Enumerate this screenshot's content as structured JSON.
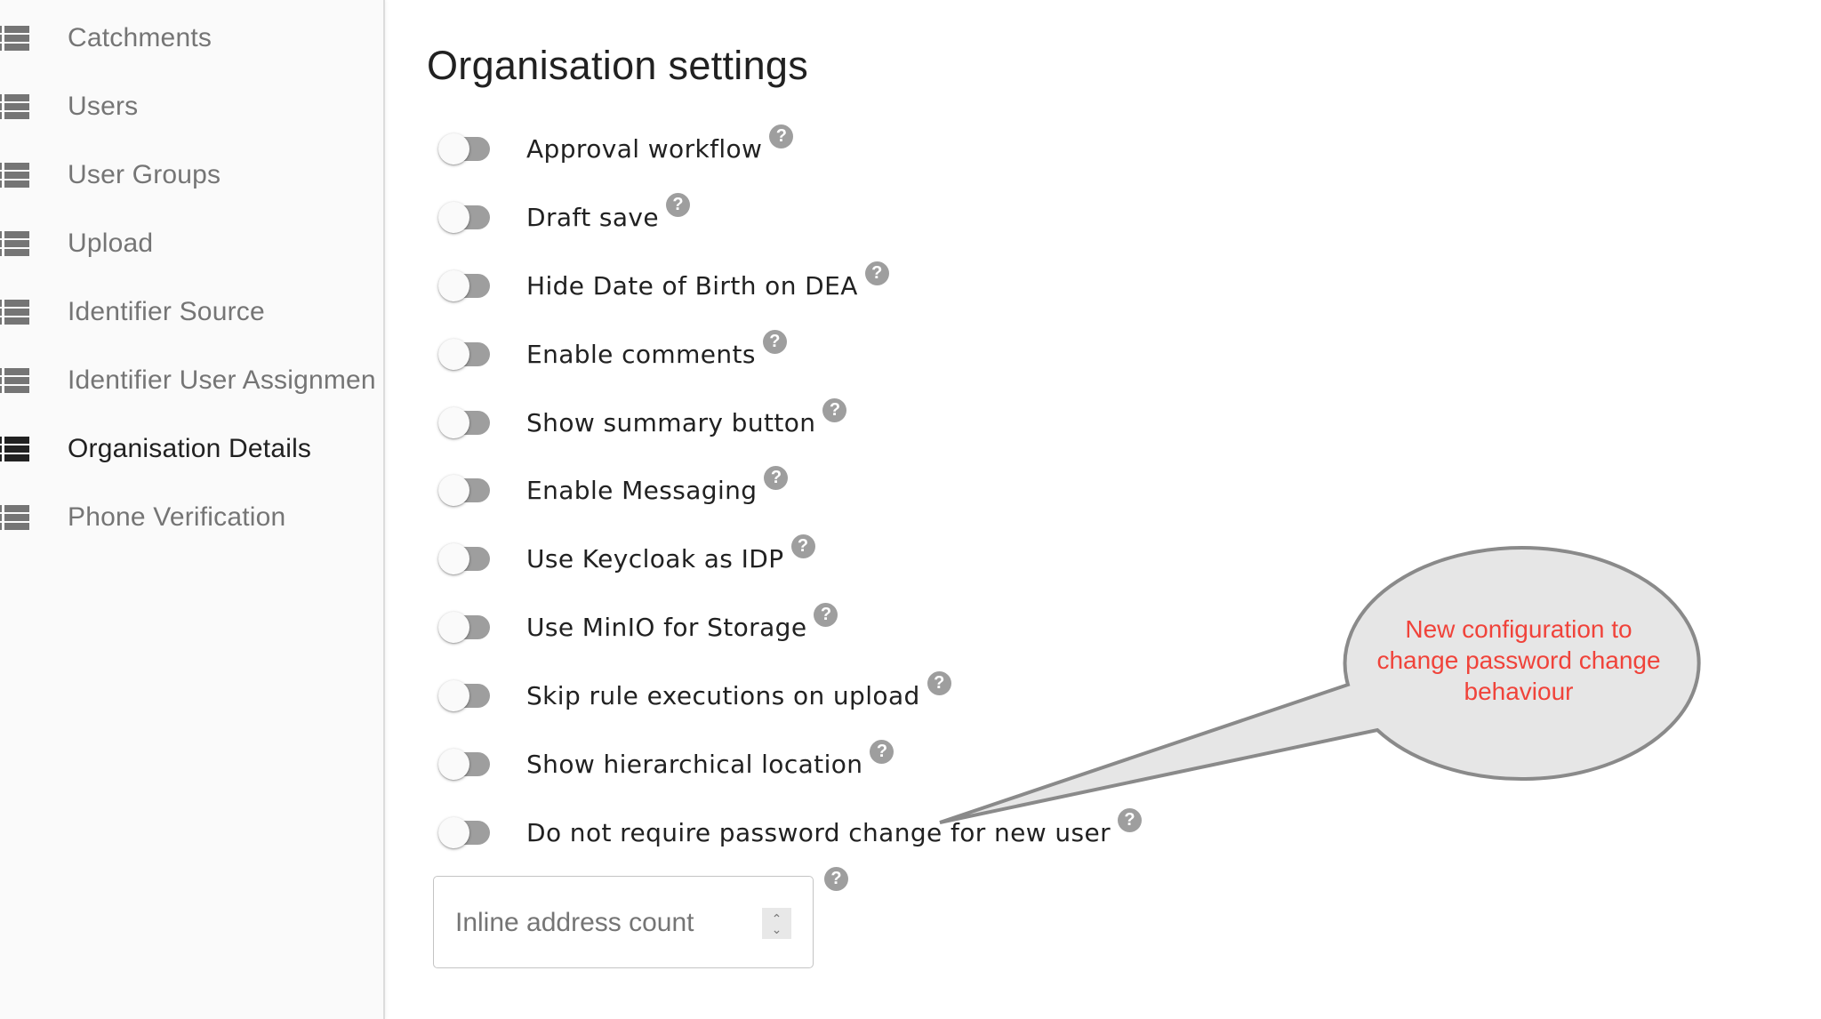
{
  "sidebar": {
    "items": [
      {
        "label": "Catchments",
        "icon": "view-list-icon",
        "active": false
      },
      {
        "label": "Users",
        "icon": "view-list-icon",
        "active": false
      },
      {
        "label": "User Groups",
        "icon": "view-list-icon",
        "active": false
      },
      {
        "label": "Upload",
        "icon": "view-list-icon",
        "active": false
      },
      {
        "label": "Identifier Source",
        "icon": "view-list-icon",
        "active": false
      },
      {
        "label": "Identifier User Assignmen",
        "icon": "view-list-icon",
        "active": false
      },
      {
        "label": "Organisation Details",
        "icon": "view-list-icon",
        "active": true
      },
      {
        "label": "Phone Verification",
        "icon": "view-list-icon",
        "active": false
      }
    ]
  },
  "main": {
    "title": "Organisation settings",
    "settings": [
      {
        "label": "Approval workflow",
        "enabled": false,
        "help": "?"
      },
      {
        "label": "Draft save",
        "enabled": false,
        "help": "?"
      },
      {
        "label": "Hide Date of Birth on DEA",
        "enabled": false,
        "help": "?"
      },
      {
        "label": "Enable comments",
        "enabled": false,
        "help": "?"
      },
      {
        "label": "Show summary button",
        "enabled": false,
        "help": "?"
      },
      {
        "label": "Enable Messaging",
        "enabled": false,
        "help": "?"
      },
      {
        "label": "Use Keycloak as IDP",
        "enabled": false,
        "help": "?"
      },
      {
        "label": "Use MinIO for Storage",
        "enabled": false,
        "help": "?"
      },
      {
        "label": "Skip rule executions on upload",
        "enabled": false,
        "help": "?"
      },
      {
        "label": "Show hierarchical location",
        "enabled": false,
        "help": "?"
      },
      {
        "label": "Do not require password change for new user",
        "enabled": false,
        "help": "?"
      }
    ],
    "inline_address_count": {
      "placeholder": "Inline address count",
      "value": "",
      "help": "?"
    }
  },
  "annotation": {
    "text_lines": [
      "New configuration to",
      "change password change",
      "behaviour"
    ],
    "text_color": "#f0433a",
    "fill_color": "#e6e6e6",
    "stroke_color": "#8a8a8a"
  }
}
